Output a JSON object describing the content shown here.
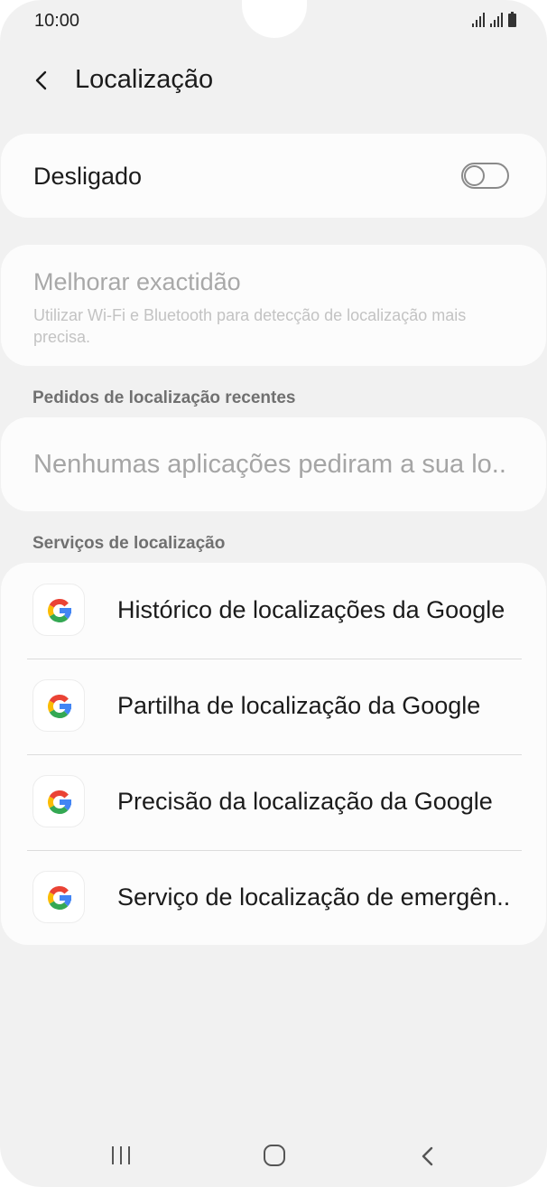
{
  "status_bar": {
    "time": "10:00"
  },
  "header": {
    "title": "Localização",
    "back_icon": "back-chevron-icon"
  },
  "location_toggle": {
    "label": "Desligado",
    "state": "off"
  },
  "improve_accuracy": {
    "title": "Melhorar exactidão",
    "description": "Utilizar Wi-Fi e Bluetooth para detecção de localização mais precisa."
  },
  "recent_requests": {
    "header": "Pedidos de localização recentes",
    "empty_text": "Nenhumas aplicações pediram a sua localização recentemente"
  },
  "location_services": {
    "header": "Serviços de localização",
    "items": [
      {
        "label": "Histórico de localizações da Google",
        "icon": "google-icon"
      },
      {
        "label": "Partilha de localização da Google",
        "icon": "google-icon"
      },
      {
        "label": "Precisão da localização da Google",
        "icon": "google-icon"
      },
      {
        "label": "Serviço de localização de emergência",
        "icon": "google-icon"
      }
    ]
  },
  "nav_bar": {
    "recents_icon": "recents-icon",
    "home_icon": "home-icon",
    "back_icon": "back-icon"
  },
  "colors": {
    "background": "#f1f1f1",
    "card": "#fcfcfc",
    "google_blue": "#4285F4",
    "google_red": "#EA4335",
    "google_yellow": "#FBBC05",
    "google_green": "#34A853"
  }
}
